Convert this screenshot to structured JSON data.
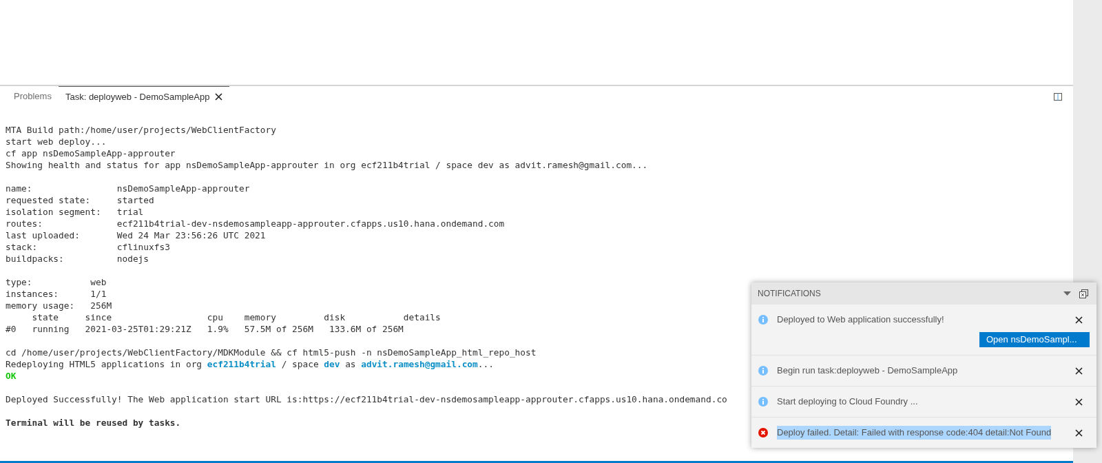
{
  "tabs": [
    {
      "label": "Problems",
      "selected": false
    },
    {
      "label": "Task: deployweb - DemoSampleApp",
      "selected": true
    }
  ],
  "terminal": {
    "lines": [
      {
        "gap_before": false,
        "segments": [
          {
            "kind": "plain",
            "text": "MTA Build path:/home/user/projects/WebClientFactory"
          }
        ]
      },
      {
        "gap_before": false,
        "segments": [
          {
            "kind": "plain",
            "text": "start web deploy..."
          }
        ]
      },
      {
        "gap_before": false,
        "segments": [
          {
            "kind": "plain",
            "text": "cf app nsDemoSampleApp-approuter"
          }
        ]
      },
      {
        "gap_before": false,
        "segments": [
          {
            "kind": "plain",
            "text": "Showing health and status for app nsDemoSampleApp-approuter in org ecf211b4trial / space dev as advit.ramesh@gmail.com..."
          }
        ]
      },
      {
        "gap_before": true,
        "segments": [
          {
            "kind": "plain",
            "text": "name:                nsDemoSampleApp-approuter"
          }
        ]
      },
      {
        "gap_before": false,
        "segments": [
          {
            "kind": "plain",
            "text": "requested state:     started"
          }
        ]
      },
      {
        "gap_before": false,
        "segments": [
          {
            "kind": "plain",
            "text": "isolation segment:   trial"
          }
        ]
      },
      {
        "gap_before": false,
        "segments": [
          {
            "kind": "plain",
            "text": "routes:              ecf211b4trial-dev-nsdemosampleapp-approuter.cfapps.us10.hana.ondemand.com"
          }
        ]
      },
      {
        "gap_before": false,
        "segments": [
          {
            "kind": "plain",
            "text": "last uploaded:       Wed 24 Mar 23:56:26 UTC 2021"
          }
        ]
      },
      {
        "gap_before": false,
        "segments": [
          {
            "kind": "plain",
            "text": "stack:               cflinuxfs3"
          }
        ]
      },
      {
        "gap_before": false,
        "segments": [
          {
            "kind": "plain",
            "text": "buildpacks:          nodejs"
          }
        ]
      },
      {
        "gap_before": true,
        "segments": [
          {
            "kind": "plain",
            "text": "type:           web"
          }
        ]
      },
      {
        "gap_before": false,
        "segments": [
          {
            "kind": "plain",
            "text": "instances:      1/1"
          }
        ]
      },
      {
        "gap_before": false,
        "segments": [
          {
            "kind": "plain",
            "text": "memory usage:   256M"
          }
        ]
      },
      {
        "gap_before": false,
        "segments": [
          {
            "kind": "plain",
            "text": "     state     since                  cpu    memory         disk           details"
          }
        ]
      },
      {
        "gap_before": false,
        "segments": [
          {
            "kind": "plain",
            "text": "#0   running   2021-03-25T01:29:21Z   1.9%   57.5M of 256M   133.6M of 256M"
          }
        ]
      },
      {
        "gap_before": true,
        "segments": [
          {
            "kind": "plain",
            "text": "cd /home/user/projects/WebClientFactory/MDKModule && cf html5-push -n nsDemoSampleApp_html_repo_host"
          }
        ]
      },
      {
        "gap_before": false,
        "segments": [
          {
            "kind": "plain",
            "text": "Redeploying HTML5 applications in org "
          },
          {
            "kind": "highlight",
            "text": "ecf211b4trial"
          },
          {
            "kind": "plain",
            "text": " / space "
          },
          {
            "kind": "highlight",
            "text": "dev"
          },
          {
            "kind": "plain",
            "text": " as "
          },
          {
            "kind": "highlight",
            "text": "advit.ramesh@gmail.com"
          },
          {
            "kind": "plain",
            "text": "..."
          }
        ]
      },
      {
        "gap_before": false,
        "segments": [
          {
            "kind": "success",
            "text": "OK"
          }
        ]
      },
      {
        "gap_before": true,
        "segments": [
          {
            "kind": "plain",
            "text": "Deployed Successfully! The Web application start URL is:https://ecf211b4trial-dev-nsdemosampleapp-approuter.cfapps.us10.hana.ondemand.co"
          }
        ]
      },
      {
        "gap_before": true,
        "segments": [
          {
            "kind": "bold",
            "text": "Terminal will be reused by tasks."
          }
        ]
      }
    ]
  },
  "notifications": {
    "title": "NOTIFICATIONS",
    "items": [
      {
        "kind": "info",
        "text": "Deployed to Web application successfully!",
        "button": "Open nsDemoSampl...",
        "text_selected": false
      },
      {
        "kind": "info",
        "text": "Begin run task:deployweb - DemoSampleApp",
        "text_selected": false
      },
      {
        "kind": "info",
        "text": "Start deploying to Cloud Foundry ...",
        "text_selected": false
      },
      {
        "kind": "error",
        "text": "Deploy failed. Detail: Failed with response code:404 detail:Not Found",
        "text_selected": true
      }
    ]
  }
}
